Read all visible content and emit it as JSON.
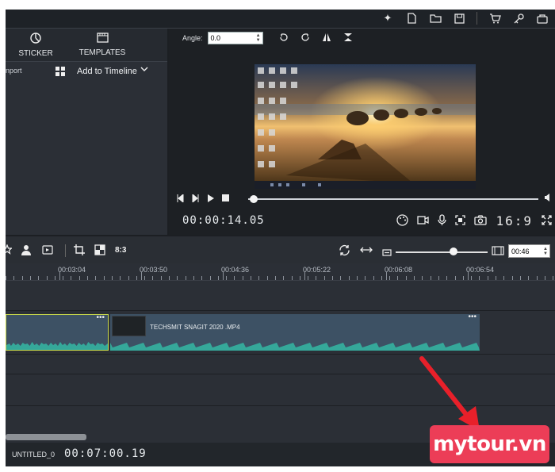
{
  "top_toolbar": {
    "icons": [
      "sparkle-icon",
      "new-file-icon",
      "open-folder-icon",
      "save-icon",
      "cart-icon",
      "key-icon",
      "bag-icon"
    ]
  },
  "left_panel": {
    "tabs": [
      {
        "label": "STICKER",
        "icon": "sticker-icon"
      },
      {
        "label": "TEMPLATES",
        "icon": "templates-icon"
      }
    ],
    "import_label": "nport",
    "add_to_timeline": "Add to Timeline"
  },
  "preview": {
    "angle_label": "Angle:",
    "angle_value": "0.0",
    "timecode": "00:00:14.05",
    "aspect_ratio": "16:9",
    "playhead_position": 0.02
  },
  "edit_toolbar": {
    "ratio_label": "8:3",
    "duration_value": "00:46",
    "zoom_level": 0.63
  },
  "timeline": {
    "ruler_labels": [
      "00:03:04",
      "00:03:50",
      "00:04:36",
      "00:05:22",
      "00:06:08",
      "00:06:54"
    ],
    "clips": [
      {
        "title": "",
        "selected": true
      },
      {
        "title": "TECHSMIT SNAGIT 2020 .MP4",
        "selected": false
      }
    ]
  },
  "status_bar": {
    "project_name": "UNTITLED_0",
    "total_time": "00:07:00.19"
  },
  "watermark": {
    "text": "mytour.vn",
    "color": "#ec3d57"
  }
}
